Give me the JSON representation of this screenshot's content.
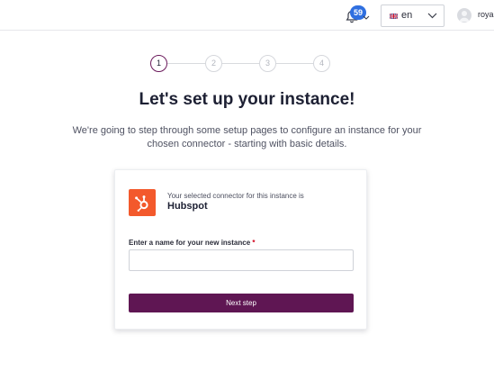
{
  "header": {
    "notifications": {
      "icon": "bell-icon",
      "count": "59"
    },
    "language": {
      "flag": "uk-flag-icon",
      "selected": "en"
    },
    "user": {
      "name": "roya."
    }
  },
  "stepper": {
    "steps": [
      "1",
      "2",
      "3",
      "4"
    ],
    "active_step": 1,
    "active_color": "#6b1a5c"
  },
  "main": {
    "title": "Let's set up your instance!",
    "subtitle": "We're going to step through some setup pages to configure an instance for your chosen connector - starting with basic details."
  },
  "card": {
    "connector_icon": "hubspot-logo-icon",
    "connector_caption": "Your selected connector for this instance is",
    "connector_name": "Hubspot",
    "instance_name_label": "Enter a name for your new instance",
    "required_marker": "*",
    "instance_name_value": "",
    "next_button_label": "Next step",
    "button_color": "#5f1653",
    "brand_color": "#f3592c"
  }
}
